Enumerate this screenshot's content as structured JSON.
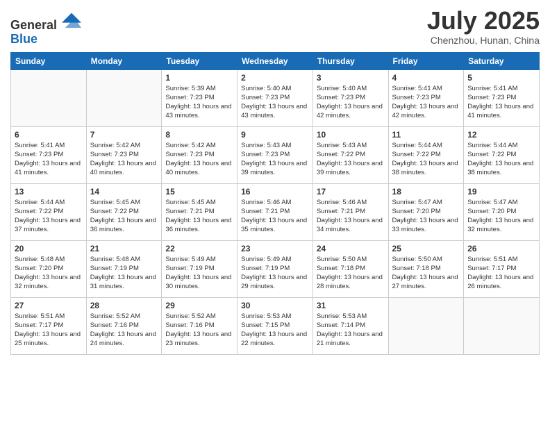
{
  "header": {
    "logo_line1": "General",
    "logo_line2": "Blue",
    "month": "July 2025",
    "location": "Chenzhou, Hunan, China"
  },
  "days_of_week": [
    "Sunday",
    "Monday",
    "Tuesday",
    "Wednesday",
    "Thursday",
    "Friday",
    "Saturday"
  ],
  "weeks": [
    [
      {
        "day": "",
        "sunrise": "",
        "sunset": "",
        "daylight": ""
      },
      {
        "day": "",
        "sunrise": "",
        "sunset": "",
        "daylight": ""
      },
      {
        "day": "1",
        "sunrise": "Sunrise: 5:39 AM",
        "sunset": "Sunset: 7:23 PM",
        "daylight": "Daylight: 13 hours and 43 minutes."
      },
      {
        "day": "2",
        "sunrise": "Sunrise: 5:40 AM",
        "sunset": "Sunset: 7:23 PM",
        "daylight": "Daylight: 13 hours and 43 minutes."
      },
      {
        "day": "3",
        "sunrise": "Sunrise: 5:40 AM",
        "sunset": "Sunset: 7:23 PM",
        "daylight": "Daylight: 13 hours and 42 minutes."
      },
      {
        "day": "4",
        "sunrise": "Sunrise: 5:41 AM",
        "sunset": "Sunset: 7:23 PM",
        "daylight": "Daylight: 13 hours and 42 minutes."
      },
      {
        "day": "5",
        "sunrise": "Sunrise: 5:41 AM",
        "sunset": "Sunset: 7:23 PM",
        "daylight": "Daylight: 13 hours and 41 minutes."
      }
    ],
    [
      {
        "day": "6",
        "sunrise": "Sunrise: 5:41 AM",
        "sunset": "Sunset: 7:23 PM",
        "daylight": "Daylight: 13 hours and 41 minutes."
      },
      {
        "day": "7",
        "sunrise": "Sunrise: 5:42 AM",
        "sunset": "Sunset: 7:23 PM",
        "daylight": "Daylight: 13 hours and 40 minutes."
      },
      {
        "day": "8",
        "sunrise": "Sunrise: 5:42 AM",
        "sunset": "Sunset: 7:23 PM",
        "daylight": "Daylight: 13 hours and 40 minutes."
      },
      {
        "day": "9",
        "sunrise": "Sunrise: 5:43 AM",
        "sunset": "Sunset: 7:23 PM",
        "daylight": "Daylight: 13 hours and 39 minutes."
      },
      {
        "day": "10",
        "sunrise": "Sunrise: 5:43 AM",
        "sunset": "Sunset: 7:22 PM",
        "daylight": "Daylight: 13 hours and 39 minutes."
      },
      {
        "day": "11",
        "sunrise": "Sunrise: 5:44 AM",
        "sunset": "Sunset: 7:22 PM",
        "daylight": "Daylight: 13 hours and 38 minutes."
      },
      {
        "day": "12",
        "sunrise": "Sunrise: 5:44 AM",
        "sunset": "Sunset: 7:22 PM",
        "daylight": "Daylight: 13 hours and 38 minutes."
      }
    ],
    [
      {
        "day": "13",
        "sunrise": "Sunrise: 5:44 AM",
        "sunset": "Sunset: 7:22 PM",
        "daylight": "Daylight: 13 hours and 37 minutes."
      },
      {
        "day": "14",
        "sunrise": "Sunrise: 5:45 AM",
        "sunset": "Sunset: 7:22 PM",
        "daylight": "Daylight: 13 hours and 36 minutes."
      },
      {
        "day": "15",
        "sunrise": "Sunrise: 5:45 AM",
        "sunset": "Sunset: 7:21 PM",
        "daylight": "Daylight: 13 hours and 36 minutes."
      },
      {
        "day": "16",
        "sunrise": "Sunrise: 5:46 AM",
        "sunset": "Sunset: 7:21 PM",
        "daylight": "Daylight: 13 hours and 35 minutes."
      },
      {
        "day": "17",
        "sunrise": "Sunrise: 5:46 AM",
        "sunset": "Sunset: 7:21 PM",
        "daylight": "Daylight: 13 hours and 34 minutes."
      },
      {
        "day": "18",
        "sunrise": "Sunrise: 5:47 AM",
        "sunset": "Sunset: 7:20 PM",
        "daylight": "Daylight: 13 hours and 33 minutes."
      },
      {
        "day": "19",
        "sunrise": "Sunrise: 5:47 AM",
        "sunset": "Sunset: 7:20 PM",
        "daylight": "Daylight: 13 hours and 32 minutes."
      }
    ],
    [
      {
        "day": "20",
        "sunrise": "Sunrise: 5:48 AM",
        "sunset": "Sunset: 7:20 PM",
        "daylight": "Daylight: 13 hours and 32 minutes."
      },
      {
        "day": "21",
        "sunrise": "Sunrise: 5:48 AM",
        "sunset": "Sunset: 7:19 PM",
        "daylight": "Daylight: 13 hours and 31 minutes."
      },
      {
        "day": "22",
        "sunrise": "Sunrise: 5:49 AM",
        "sunset": "Sunset: 7:19 PM",
        "daylight": "Daylight: 13 hours and 30 minutes."
      },
      {
        "day": "23",
        "sunrise": "Sunrise: 5:49 AM",
        "sunset": "Sunset: 7:19 PM",
        "daylight": "Daylight: 13 hours and 29 minutes."
      },
      {
        "day": "24",
        "sunrise": "Sunrise: 5:50 AM",
        "sunset": "Sunset: 7:18 PM",
        "daylight": "Daylight: 13 hours and 28 minutes."
      },
      {
        "day": "25",
        "sunrise": "Sunrise: 5:50 AM",
        "sunset": "Sunset: 7:18 PM",
        "daylight": "Daylight: 13 hours and 27 minutes."
      },
      {
        "day": "26",
        "sunrise": "Sunrise: 5:51 AM",
        "sunset": "Sunset: 7:17 PM",
        "daylight": "Daylight: 13 hours and 26 minutes."
      }
    ],
    [
      {
        "day": "27",
        "sunrise": "Sunrise: 5:51 AM",
        "sunset": "Sunset: 7:17 PM",
        "daylight": "Daylight: 13 hours and 25 minutes."
      },
      {
        "day": "28",
        "sunrise": "Sunrise: 5:52 AM",
        "sunset": "Sunset: 7:16 PM",
        "daylight": "Daylight: 13 hours and 24 minutes."
      },
      {
        "day": "29",
        "sunrise": "Sunrise: 5:52 AM",
        "sunset": "Sunset: 7:16 PM",
        "daylight": "Daylight: 13 hours and 23 minutes."
      },
      {
        "day": "30",
        "sunrise": "Sunrise: 5:53 AM",
        "sunset": "Sunset: 7:15 PM",
        "daylight": "Daylight: 13 hours and 22 minutes."
      },
      {
        "day": "31",
        "sunrise": "Sunrise: 5:53 AM",
        "sunset": "Sunset: 7:14 PM",
        "daylight": "Daylight: 13 hours and 21 minutes."
      },
      {
        "day": "",
        "sunrise": "",
        "sunset": "",
        "daylight": ""
      },
      {
        "day": "",
        "sunrise": "",
        "sunset": "",
        "daylight": ""
      }
    ]
  ]
}
